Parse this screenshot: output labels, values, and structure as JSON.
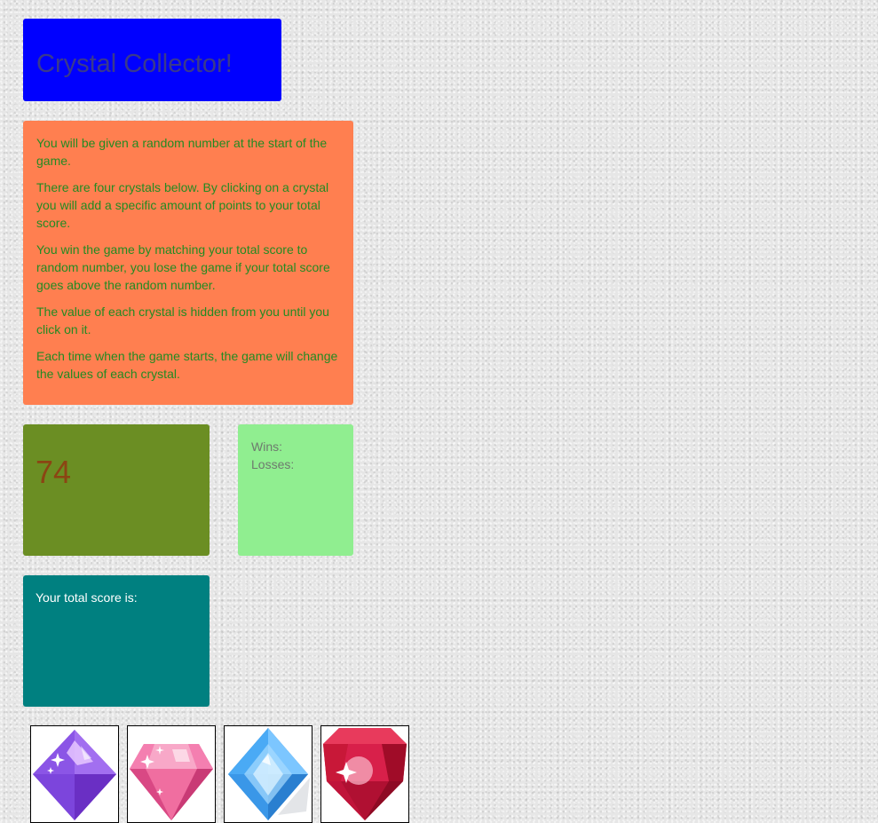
{
  "header": {
    "title": "Crystal Collector!"
  },
  "instructions": {
    "paragraphs": [
      "You will be given a random number at the start of the game.",
      "There are four crystals below. By clicking on a crystal you will add a specific amount of points to your total score.",
      "You win the game by matching your total score to random number, you lose the game if your total score goes above the random number.",
      "The value of each crystal is hidden from you until you click on it.",
      "Each time when the game starts, the game will change the values of each crystal."
    ]
  },
  "game": {
    "target_number": "74",
    "wins_label": "Wins:",
    "losses_label": "Losses:",
    "score_label": "Your total score is:"
  },
  "crystals": [
    {
      "icon": "purple-crystal-icon",
      "color": "#8b4fe0"
    },
    {
      "icon": "pink-crystal-icon",
      "color": "#f06ea0"
    },
    {
      "icon": "blue-crystal-icon",
      "color": "#3fa4f0"
    },
    {
      "icon": "red-crystal-icon",
      "color": "#d0163c"
    }
  ],
  "colors": {
    "title_bg": "#0000ff",
    "instructions_bg": "#ff7f50",
    "target_bg": "#6b8e23",
    "stats_bg": "#90ee90",
    "score_bg": "#008080"
  }
}
